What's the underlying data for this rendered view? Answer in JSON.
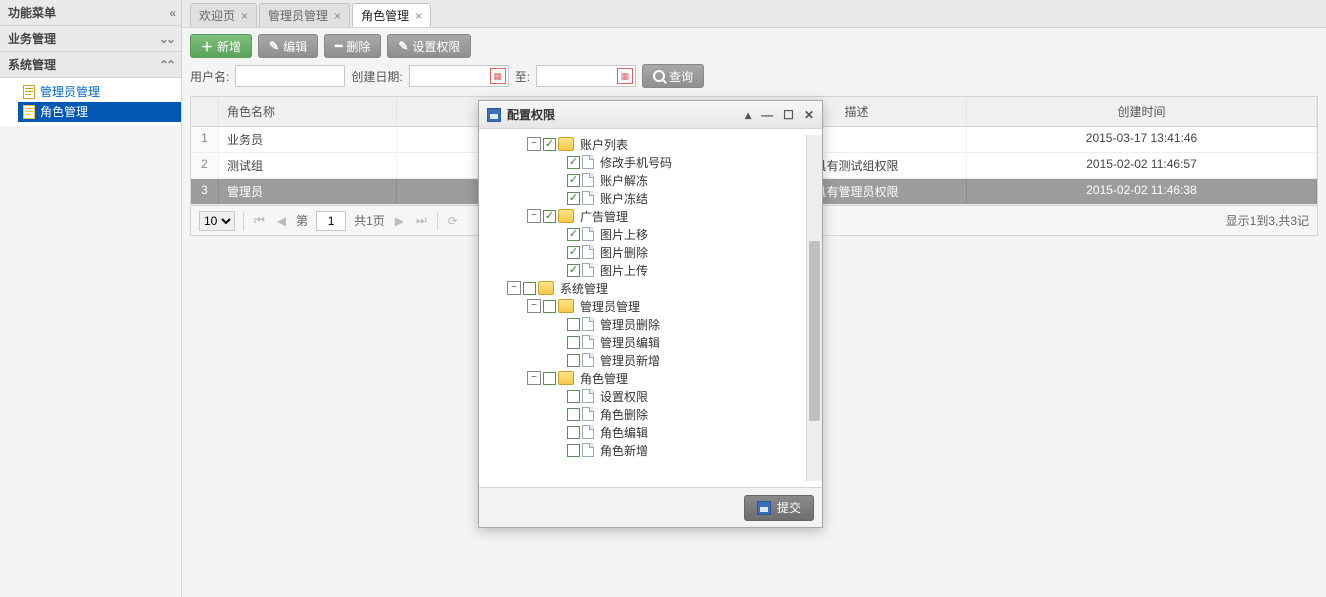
{
  "sidebar": {
    "title": "功能菜单",
    "groups": [
      {
        "label": "业务管理",
        "expanded": false
      },
      {
        "label": "系统管理",
        "expanded": true,
        "items": [
          {
            "label": "管理员管理",
            "selected": false
          },
          {
            "label": "角色管理",
            "selected": true
          }
        ]
      }
    ]
  },
  "tabs": [
    {
      "label": "欢迎页",
      "active": false
    },
    {
      "label": "管理员管理",
      "active": false
    },
    {
      "label": "角色管理",
      "active": true
    }
  ],
  "toolbar": {
    "add": "新增",
    "edit": "编辑",
    "delete": "删除",
    "setperm": "设置权限"
  },
  "search": {
    "username_label": "用户名:",
    "created_label": "创建日期:",
    "to_label": "至:",
    "query": "查询"
  },
  "grid": {
    "columns": {
      "name": "角色名称",
      "desc": "描述",
      "created": "创建时间"
    },
    "rows": [
      {
        "idx": "1",
        "name": "业务员",
        "desc": "",
        "created": "2015-03-17 13:41:46",
        "selected": false
      },
      {
        "idx": "2",
        "name": "测试组",
        "desc": "具有测试组权限",
        "created": "2015-02-02 11:46:57",
        "selected": false
      },
      {
        "idx": "3",
        "name": "管理员",
        "desc": "具有管理员权限",
        "created": "2015-02-02 11:46:38",
        "selected": true
      }
    ]
  },
  "pager": {
    "page_size": "10",
    "page_label_prefix": "第",
    "page": "1",
    "total_pages_label": "共1页",
    "info": "显示1到3,共3记"
  },
  "dialog": {
    "title": "配置权限",
    "submit": "提交",
    "tree": [
      {
        "d": 2,
        "exp": "-",
        "chk": true,
        "type": "folder",
        "label": "账户列表"
      },
      {
        "d": 3,
        "exp": "",
        "chk": true,
        "type": "file",
        "label": "修改手机号码"
      },
      {
        "d": 3,
        "exp": "",
        "chk": true,
        "type": "file",
        "label": "账户解冻"
      },
      {
        "d": 3,
        "exp": "",
        "chk": true,
        "type": "file",
        "label": "账户冻结"
      },
      {
        "d": 2,
        "exp": "-",
        "chk": true,
        "type": "folder",
        "label": "广告管理"
      },
      {
        "d": 3,
        "exp": "",
        "chk": true,
        "type": "file",
        "label": "图片上移"
      },
      {
        "d": 3,
        "exp": "",
        "chk": true,
        "type": "file",
        "label": "图片删除"
      },
      {
        "d": 3,
        "exp": "",
        "chk": true,
        "type": "file",
        "label": "图片上传"
      },
      {
        "d": 1,
        "exp": "-",
        "chk": false,
        "type": "folder",
        "label": "系统管理"
      },
      {
        "d": 2,
        "exp": "-",
        "chk": false,
        "type": "folder",
        "label": "管理员管理"
      },
      {
        "d": 3,
        "exp": "",
        "chk": false,
        "type": "file",
        "label": "管理员删除"
      },
      {
        "d": 3,
        "exp": "",
        "chk": false,
        "type": "file",
        "label": "管理员编辑"
      },
      {
        "d": 3,
        "exp": "",
        "chk": false,
        "type": "file",
        "label": "管理员新增"
      },
      {
        "d": 2,
        "exp": "-",
        "chk": false,
        "type": "folder",
        "label": "角色管理"
      },
      {
        "d": 3,
        "exp": "",
        "chk": false,
        "type": "file",
        "label": "设置权限"
      },
      {
        "d": 3,
        "exp": "",
        "chk": false,
        "type": "file",
        "label": "角色删除"
      },
      {
        "d": 3,
        "exp": "",
        "chk": false,
        "type": "file",
        "label": "角色编辑"
      },
      {
        "d": 3,
        "exp": "",
        "chk": false,
        "type": "file",
        "label": "角色新增"
      }
    ]
  }
}
